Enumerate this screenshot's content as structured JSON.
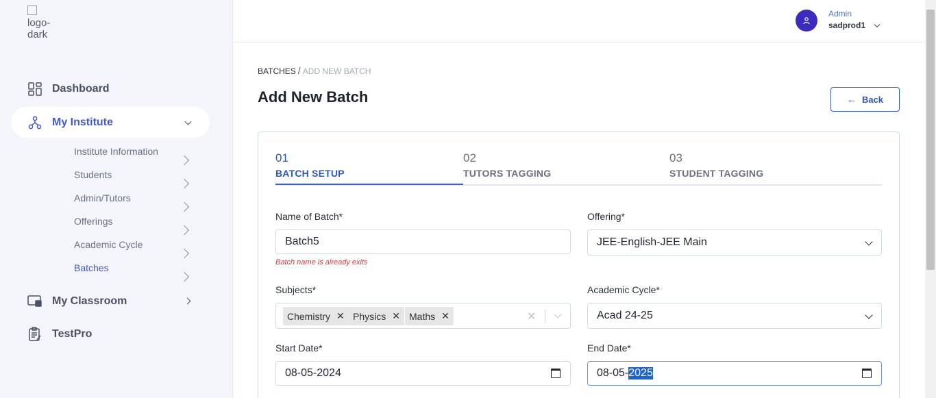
{
  "sidebar": {
    "logo_alt": "logo-dark",
    "items": [
      {
        "label": "Dashboard",
        "icon": "dashboard-icon"
      },
      {
        "label": "My Institute",
        "icon": "org-chart-icon",
        "active": true
      },
      {
        "label": "My Classroom",
        "icon": "classroom-icon"
      },
      {
        "label": "TestPro",
        "icon": "test-clipboard-icon"
      }
    ],
    "sub_items": [
      {
        "label": "Institute Information"
      },
      {
        "label": "Students"
      },
      {
        "label": "Admin/Tutors"
      },
      {
        "label": "Offerings"
      },
      {
        "label": "Academic Cycle"
      },
      {
        "label": "Batches",
        "active": true
      }
    ]
  },
  "header": {
    "user_role": "Admin",
    "user_name": "sadprod1"
  },
  "breadcrumb": {
    "root": "BATCHES",
    "separator": "/",
    "current": "ADD NEW BATCH"
  },
  "page": {
    "title": "Add New Batch",
    "back_label": "Back"
  },
  "steps": [
    {
      "num": "01",
      "label": "BATCH SETUP",
      "active": true
    },
    {
      "num": "02",
      "label": "TUTORS TAGGING"
    },
    {
      "num": "03",
      "label": "STUDENT TAGGING"
    }
  ],
  "form": {
    "batch_name_label": "Name of Batch*",
    "batch_name_value": "Batch5",
    "batch_name_error": "Batch name is already exits",
    "offering_label": "Offering*",
    "offering_value": "JEE-English-JEE Main",
    "subjects_label": "Subjects*",
    "subjects": [
      "Chemistry",
      "Physics",
      "Maths"
    ],
    "academic_cycle_label": "Academic Cycle*",
    "academic_cycle_value": "Acad 24-25",
    "start_date_label": "Start Date*",
    "start_date_value": "08-05-2024",
    "end_date_label": "End Date*",
    "end_date_prefix": "08-05-",
    "end_date_selected": "2025"
  },
  "colors": {
    "accent": "#2a58c8",
    "avatar": "#3b2bbf",
    "error": "#d93a3a",
    "sidebar_bg": "#f3f5fa"
  }
}
